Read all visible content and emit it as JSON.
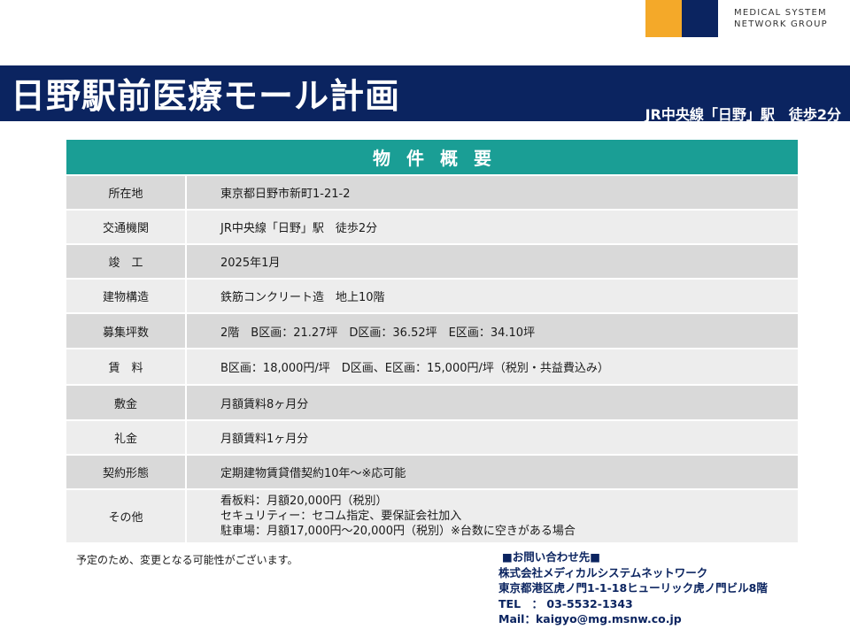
{
  "logo": {
    "line1": "MEDICAL SYSTEM",
    "line2": "NETWORK GROUP",
    "colors": {
      "orange": "#f4a929",
      "navy": "#0b2460"
    }
  },
  "header": {
    "title": "日野駅前医療モール計画",
    "subtitle": "JR中央線「日野」駅　徒歩2分"
  },
  "table": {
    "heading": "物件概要",
    "rows": [
      {
        "label": "所在地",
        "value": "東京都日野市新町1-21-2"
      },
      {
        "label": "交通機関",
        "value": "JR中央線「日野」駅　徒歩2分"
      },
      {
        "label": "竣　工",
        "value": "2025年1月"
      },
      {
        "label": "建物構造",
        "value": "鉄筋コンクリート造　地上10階"
      },
      {
        "label": "募集坪数",
        "value": "2階　B区画：21.27坪　D区画：36.52坪　E区画：34.10坪"
      },
      {
        "label": "賃　料",
        "value": "B区画：18,000円/坪　D区画、E区画：15,000円/坪（税別・共益費込み）"
      },
      {
        "label": "敷金",
        "value": "月額賃料8ヶ月分"
      },
      {
        "label": "礼金",
        "value": "月額賃料1ヶ月分"
      },
      {
        "label": "契約形態",
        "value": "定期建物賃貸借契約10年～※応可能"
      },
      {
        "label": "その他",
        "lines": [
          "看板料：月額20,000円（税別）",
          "セキュリティー：セコム指定、要保証会社加入",
          "駐車場：月額17,000円～20,000円（税別）※台数に空きがある場合"
        ]
      }
    ]
  },
  "note": "予定のため、変更となる可能性がございます。",
  "contact": {
    "heading": "■お問い合わせ先■",
    "company": "株式会社メディカルシステムネットワーク",
    "address": "東京都港区虎ノ門1-1-18ヒューリック虎ノ門ビル8階",
    "tel": "TEL　：  03-5532-1343",
    "mail": "Mail：kaigyo@mg.msnw.co.jp"
  }
}
